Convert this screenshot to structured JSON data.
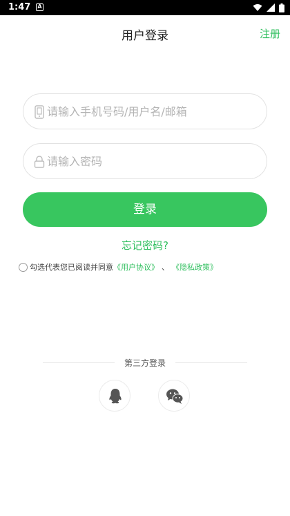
{
  "status_bar": {
    "time": "1:47",
    "notification_glyph": "A"
  },
  "header": {
    "title": "用户登录",
    "register_label": "注册"
  },
  "form": {
    "account_placeholder": "请输入手机号码/用户名/邮箱",
    "password_placeholder": "请输入密码",
    "account_value": "",
    "password_value": "",
    "login_label": "登录",
    "forgot_label": "忘记密码?"
  },
  "agreement": {
    "text": "勾选代表您已阅读并同意",
    "user_agreement": "《用户协议》",
    "separator": "、",
    "privacy_policy": "《隐私政策》"
  },
  "third_party": {
    "label": "第三方登录",
    "providers": [
      {
        "name": "QQ",
        "icon": "qq-icon"
      },
      {
        "name": "WeChat",
        "icon": "wechat-icon"
      }
    ]
  },
  "colors": {
    "accent": "#38c65f",
    "link": "#2fbf5e",
    "border": "#e2e2e2",
    "placeholder": "#b4b4b4"
  }
}
